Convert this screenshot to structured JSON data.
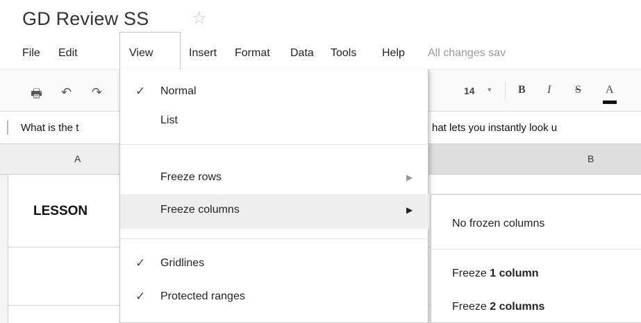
{
  "document": {
    "title": "GD Review SS",
    "star_icon": "star-outline-icon"
  },
  "menubar": {
    "items": [
      {
        "label": "File"
      },
      {
        "label": "Edit"
      },
      {
        "label": "View"
      },
      {
        "label": "Insert"
      },
      {
        "label": "Format"
      },
      {
        "label": "Data"
      },
      {
        "label": "Tools"
      },
      {
        "label": "Help"
      }
    ],
    "save_status": "All changes sav",
    "active": "View"
  },
  "toolbar": {
    "icons": [
      "print-icon",
      "undo-icon",
      "redo-icon"
    ],
    "font_size": "14",
    "bold": "B",
    "italic": "I",
    "strikethrough": "S",
    "text_color": "A"
  },
  "formula_bar": {
    "text_left": "What is the t",
    "text_right": "hat lets you instantly look u"
  },
  "grid": {
    "columns": [
      "A",
      "B"
    ],
    "cells": {
      "a1": "LESSON"
    }
  },
  "view_menu": {
    "items": [
      {
        "label": "Normal",
        "checked": true
      },
      {
        "label": "List",
        "checked": false
      },
      {
        "label": "Freeze rows",
        "has_submenu": true
      },
      {
        "label": "Freeze columns",
        "has_submenu": true,
        "highlighted": true
      },
      {
        "label": "Gridlines",
        "checked": true
      },
      {
        "label": "Protected ranges",
        "checked": true
      }
    ]
  },
  "freeze_columns_submenu": {
    "items": [
      {
        "label": "No frozen columns"
      },
      {
        "prefix": "Freeze",
        "count": "1",
        "unit": "column"
      },
      {
        "prefix": "Freeze",
        "count": "2",
        "unit": "columns"
      }
    ]
  },
  "colors": {
    "menu_highlight": "#eeeeee",
    "column_header": "#f0f0f0",
    "column_header_selected": "#dedede",
    "save_status": "#999999"
  }
}
